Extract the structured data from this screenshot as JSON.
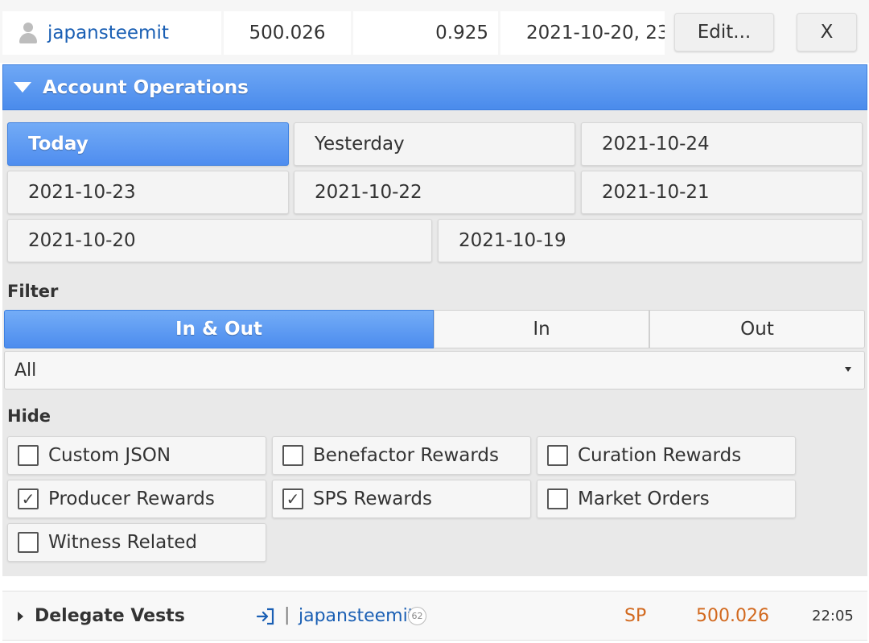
{
  "delegation": {
    "account": "japansteemit",
    "amount": "500.026",
    "apr": "0.925",
    "date": "2021-10-20, 23:",
    "edit_label": "Edit...",
    "remove_label": "X"
  },
  "operations": {
    "title": "Account Operations",
    "dates": [
      "Today",
      "Yesterday",
      "2021-10-24",
      "2021-10-23",
      "2021-10-22",
      "2021-10-21",
      "2021-10-20",
      "2021-10-19"
    ],
    "active_date": "Today",
    "filter_label": "Filter",
    "direction": [
      "In & Out",
      "In",
      "Out"
    ],
    "active_direction": "In & Out",
    "type_select": "All",
    "hide_label": "Hide",
    "hide_options": [
      {
        "label": "Custom JSON",
        "checked": false
      },
      {
        "label": "Benefactor Rewards",
        "checked": false
      },
      {
        "label": "Curation Rewards",
        "checked": false
      },
      {
        "label": "Producer Rewards",
        "checked": true
      },
      {
        "label": "SPS Rewards",
        "checked": true
      },
      {
        "label": "Market Orders",
        "checked": false
      },
      {
        "label": "Witness Related",
        "checked": false
      }
    ]
  },
  "operation_row": {
    "type": "Delegate Vests",
    "separator": "|",
    "account": "japansteemit",
    "reputation": "62",
    "unit": "SP",
    "amount": "500.026",
    "time": "22:05"
  },
  "colors": {
    "accent_blue": "#4a8bec",
    "link_blue": "#1a5fb4",
    "sp_orange": "#d2691e"
  }
}
